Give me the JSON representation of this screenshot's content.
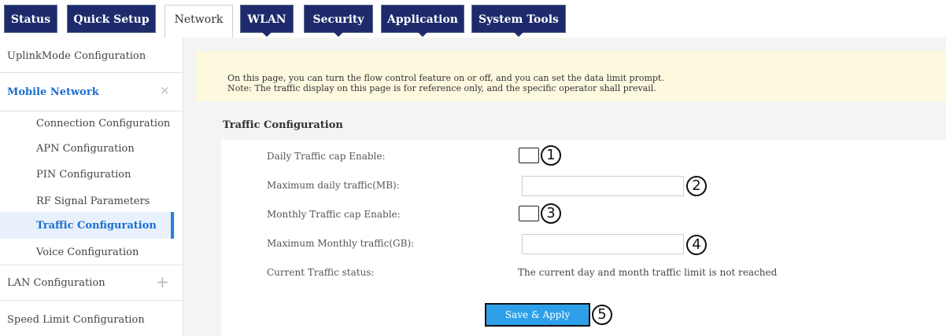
{
  "tabs": [
    {
      "label": "Status"
    },
    {
      "label": "Quick Setup"
    },
    {
      "label": "Network",
      "active": true
    },
    {
      "label": "WLAN"
    },
    {
      "label": "Security"
    },
    {
      "label": "Application"
    },
    {
      "label": "System Tools"
    }
  ],
  "sidebar": {
    "uplink": "UplinkMode Configuration",
    "mobile_network": "Mobile Network",
    "mobile_network_collapse_icon": "close-icon",
    "sub_items": [
      "Connection Configuration",
      "APN Configuration",
      "PIN Configuration",
      "RF Signal Parameters",
      "Traffic Configuration",
      "Voice Configuration"
    ],
    "active_item": "Traffic Configuration",
    "lan": "LAN Configuration",
    "lan_expand_icon": "plus-icon",
    "speed_limit": "Speed Limit Configuration"
  },
  "notice": {
    "line1": "On this page, you can turn the flow control feature on or off, and you can set the data limit prompt.",
    "line2": "Note: The traffic display on this page is for reference only, and the specific operator shall prevail."
  },
  "section_title": "Traffic Configuration",
  "form": {
    "daily_cap_label": "Daily Traffic cap Enable:",
    "daily_max_label": "Maximum daily traffic(MB):",
    "daily_max_value": "",
    "monthly_cap_label": "Monthly Traffic cap Enable:",
    "monthly_max_label": "Maximum Monthly traffic(GB):",
    "monthly_max_value": "",
    "status_label": "Current Traffic status:",
    "status_value": "The current day and month traffic limit is not reached",
    "apply_label": "Save & Apply"
  },
  "markers": [
    "1",
    "2",
    "3",
    "4",
    "5"
  ],
  "colors": {
    "tab_bg": "#1d2b6c",
    "active_link": "#1a6fd0",
    "button_bg": "#2ea0ea",
    "notice_bg": "#fdf9df"
  }
}
